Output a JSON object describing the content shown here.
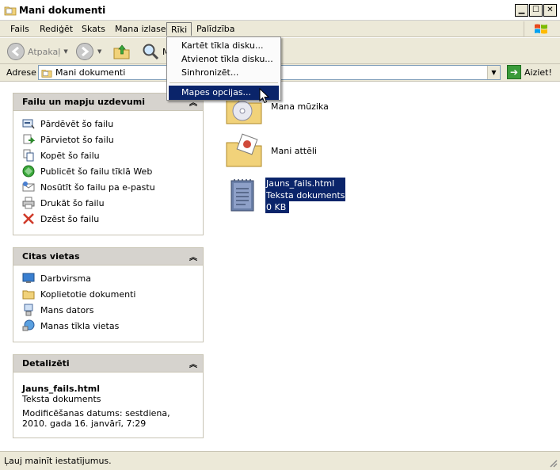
{
  "window": {
    "title": "Mani dokumenti"
  },
  "menus": [
    "Fails",
    "Rediģēt",
    "Skats",
    "Mana izlase",
    "Rīki",
    "Palīdzība"
  ],
  "toolbar": {
    "back_label": "Atpakaļ",
    "search_partial": "M"
  },
  "address": {
    "label": "Adrese",
    "value": "Mani dokumenti",
    "go_label": "Aiziet!"
  },
  "tools_menu": {
    "items": [
      "Kartēt tīkla disku...",
      "Atvienot tīkla disku...",
      "Sinhronizēt...",
      "Mapes opcijas..."
    ],
    "highlighted_index": 3
  },
  "file_tasks": {
    "title": "Failu un mapju uzdevumi",
    "items": [
      {
        "label": "Pārdēvēt šo failu",
        "icon": "rename-icon"
      },
      {
        "label": "Pārvietot šo failu",
        "icon": "move-icon"
      },
      {
        "label": "Kopēt šo failu",
        "icon": "copy-icon"
      },
      {
        "label": "Publicēt šo failu tīklā Web",
        "icon": "publish-web-icon"
      },
      {
        "label": "Nosūtīt šo failu pa e-pastu",
        "icon": "email-icon"
      },
      {
        "label": "Drukāt šo failu",
        "icon": "print-icon"
      },
      {
        "label": "Dzēst šo failu",
        "icon": "delete-icon"
      }
    ]
  },
  "other_places": {
    "title": "Citas vietas",
    "items": [
      {
        "label": "Darbvirsma",
        "icon": "desktop-icon"
      },
      {
        "label": "Koplietotie dokumenti",
        "icon": "shared-folder-icon"
      },
      {
        "label": "Mans dators",
        "icon": "my-computer-icon"
      },
      {
        "label": "Manas tīkla vietas",
        "icon": "network-places-icon"
      }
    ]
  },
  "details": {
    "title": "Detalizēti",
    "file_name": "Jauns_fails.html",
    "file_type": "Teksta dokuments",
    "modified": "Modificēšanas datums: sestdiena, 2010. gada 16. janvārī, 7:29"
  },
  "files": [
    {
      "name": "Mana mūzika",
      "type": "music-folder"
    },
    {
      "name": "Mani attēli",
      "type": "pictures-folder"
    },
    {
      "name": "Jauns_fails.html",
      "line2": "Teksta dokuments",
      "line3": "0 KB",
      "type": "text-document",
      "selected": true
    }
  ],
  "status": {
    "text": "Ļauj mainīt iestatījumus."
  },
  "colors": {
    "selection": "#0a246a",
    "chrome": "#ece9d8",
    "panel_header": "#d6d3ce"
  }
}
